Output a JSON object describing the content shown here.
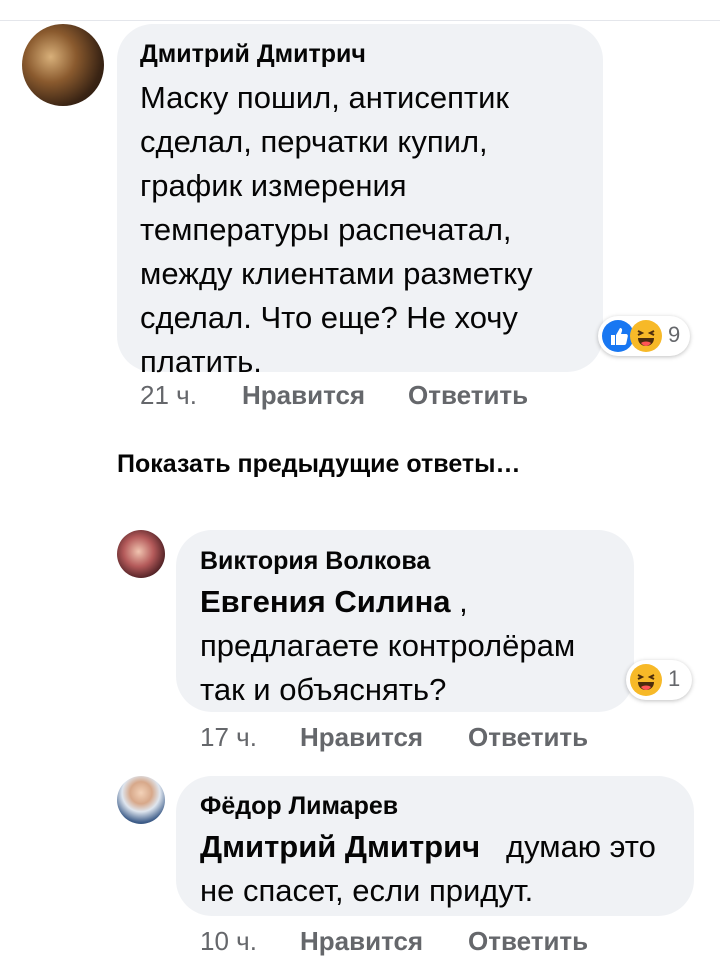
{
  "show_previous_label": "Показать предыдущие ответы…",
  "comments": [
    {
      "author": "Дмитрий Дмитрич",
      "text_lines": [
        "Маску пошил, антисептик",
        "сделал, перчатки купил,",
        "график измерения",
        "температуры распечатал,",
        "между клиентами разметку",
        "сделал. Что еще? Не хочу",
        "платить."
      ],
      "reactions": {
        "icons": [
          "like-icon",
          "haha-icon"
        ],
        "count": "9"
      },
      "time": "21 ч.",
      "like_label": "Нравится",
      "reply_label": "Ответить"
    },
    {
      "author": "Виктория Волкова",
      "mention": "Евгения Силина",
      "mention_suffix": " ,",
      "text_lines": [
        "предлагаете контролёрам",
        "так и объяснять?"
      ],
      "reactions": {
        "icons": [
          "haha-icon"
        ],
        "count": "1"
      },
      "time": "17 ч.",
      "like_label": "Нравится",
      "reply_label": "Ответить"
    },
    {
      "author": "Фёдор Лимарев",
      "mention": "Дмитрий Дмитрич",
      "mention_suffix": "   думаю это",
      "text_lines": [
        "не спасет, если придут."
      ],
      "time": "10 ч.",
      "like_label": "Нравится",
      "reply_label": "Ответить"
    }
  ],
  "colors": {
    "bubble": "#f0f2f5",
    "secondary_text": "#65676b",
    "like": "#1877f2",
    "haha": "#f7b928"
  }
}
